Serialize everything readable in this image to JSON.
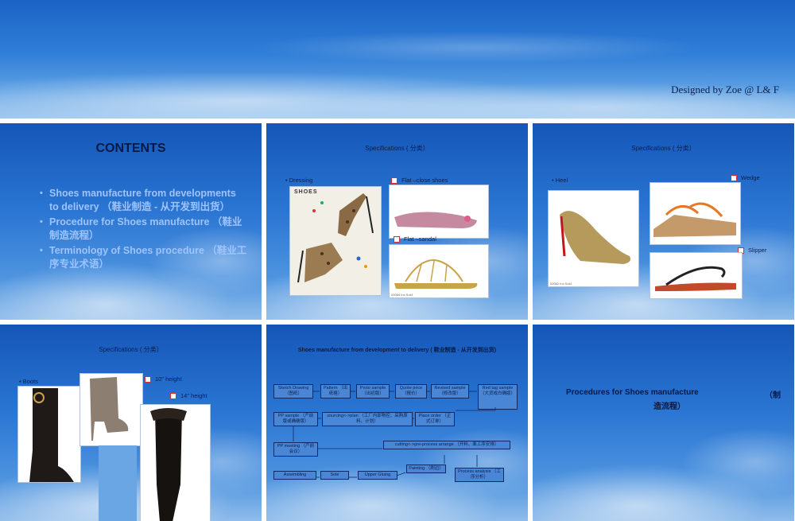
{
  "banner": {
    "credit": "Designed by Zoe @ L& F"
  },
  "slide1": {
    "title": "CONTENTS",
    "items": [
      "Shoes manufacture from developments to delivery （鞋业制造 - 从开发到出货）",
      "Procedure for Shoes manufacture （鞋业制造流程）",
      "Terminology of Shoes procedure （鞋业工序专业术语）"
    ]
  },
  "slide2": {
    "title": "Specifications ( 分类）",
    "dressing": "Dressing",
    "flat_close": "Flat –close shoes",
    "flat_sandal": "Flat –sandal",
    "magazine_word": "SHOES",
    "caption": "00084 Inc.Sold"
  },
  "slide3": {
    "title": "Specifications ( 分类）",
    "heel": "Heel",
    "wedge": "Wedge",
    "slipper": "Slipper",
    "caption": "00082 Inc.Sold"
  },
  "slide4": {
    "title": "Specifications ( 分类）",
    "boots": "Boots",
    "h10": "10\" height",
    "h14": "14\" height"
  },
  "slide5": {
    "title": "Shoes manufacture from development to delivery ( 鞋业制造 - 从开发到出货)",
    "steps": {
      "sketch": "Sketch Drawing （图纸）",
      "pattern": "Pattern （出纸格）",
      "proto": "Proto sample （出初版）",
      "quote": "Quote price （报价）",
      "revised": "Revised sample （修改版）",
      "redtag": "Red tag sample （大货成白确版）",
      "pp": "PP sample （产前版或确确版）",
      "sourcing": "sourcing<->plan （工厂内部物控、采购原料、计划）",
      "order": "Place order （正式订单）",
      "ppmeeting": "PP meeting （产前会议）",
      "cutting": "cutting<->pre-process arrange （开料、面工序安排）",
      "assembling": "Assembling",
      "sole": "Sole",
      "upper": "Upper Gluing",
      "painting": "Painting （刷边）",
      "analysis": "Process analysis （工序分析）"
    }
  },
  "slide6": {
    "title": "Procedures for Shoes manufacture",
    "suffix1": "（制",
    "suffix2": "造流程）"
  },
  "colors": {
    "sky_dark": "#1456b8",
    "sky_light": "#8fbcea",
    "toc_text": "#9ec3ff",
    "title_text": "#081a44"
  }
}
